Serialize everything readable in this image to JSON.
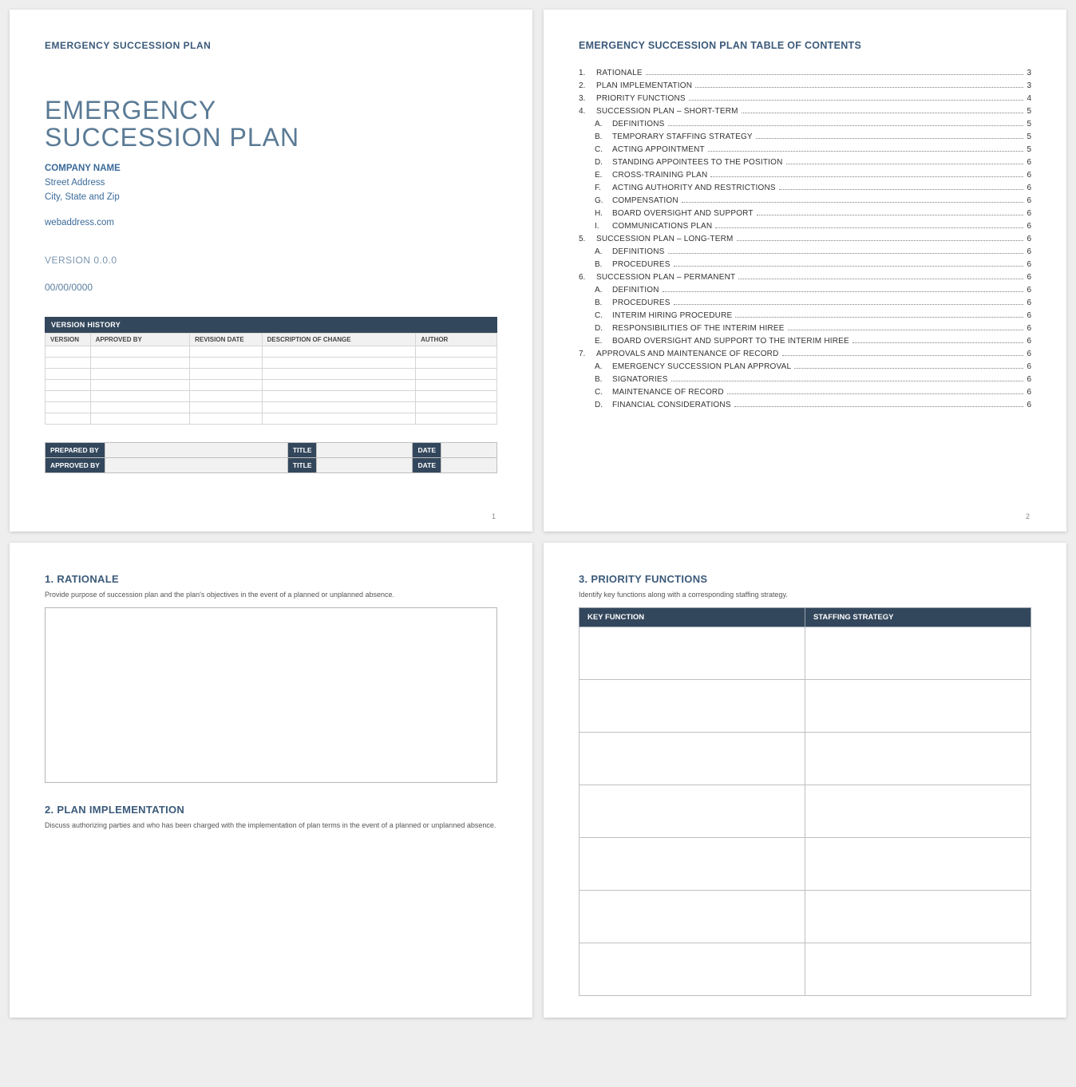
{
  "page1": {
    "header": "EMERGENCY SUCCESSION PLAN",
    "title_line1": "EMERGENCY",
    "title_line2": "SUCCESSION PLAN",
    "company_name": "COMPANY NAME",
    "street": "Street Address",
    "city_state_zip": "City, State and Zip",
    "web": "webaddress.com",
    "version_label": "VERSION 0.0.0",
    "date_label": "00/00/0000",
    "vh_title": "VERSION HISTORY",
    "vh_cols": {
      "c0": "VERSION",
      "c1": "APPROVED BY",
      "c2": "REVISION DATE",
      "c3": "DESCRIPTION OF CHANGE",
      "c4": "AUTHOR"
    },
    "sign": {
      "prepared_by": "PREPARED BY",
      "approved_by": "APPROVED BY",
      "title": "TITLE",
      "date": "DATE"
    },
    "pgnum": "1"
  },
  "page2": {
    "title": "EMERGENCY SUCCESSION PLAN TABLE OF CONTENTS",
    "toc": [
      {
        "m": "1.",
        "t": "RATIONALE",
        "p": "3",
        "sub": false
      },
      {
        "m": "2.",
        "t": "PLAN IMPLEMENTATION",
        "p": "3",
        "sub": false
      },
      {
        "m": "3.",
        "t": "PRIORITY FUNCTIONS",
        "p": "4",
        "sub": false
      },
      {
        "m": "4.",
        "t": "SUCCESSION PLAN – SHORT-TERM",
        "p": "5",
        "sub": false
      },
      {
        "m": "A.",
        "t": "DEFINITIONS",
        "p": "5",
        "sub": true
      },
      {
        "m": "B.",
        "t": "TEMPORARY STAFFING STRATEGY",
        "p": "5",
        "sub": true
      },
      {
        "m": "C.",
        "t": "ACTING APPOINTMENT",
        "p": "5",
        "sub": true
      },
      {
        "m": "D.",
        "t": "STANDING APPOINTEES TO THE POSITION",
        "p": "6",
        "sub": true
      },
      {
        "m": "E.",
        "t": "CROSS-TRAINING PLAN",
        "p": "6",
        "sub": true
      },
      {
        "m": "F.",
        "t": "ACTING AUTHORITY AND RESTRICTIONS",
        "p": "6",
        "sub": true
      },
      {
        "m": "G.",
        "t": "COMPENSATION",
        "p": "6",
        "sub": true
      },
      {
        "m": "H.",
        "t": "BOARD OVERSIGHT AND SUPPORT",
        "p": "6",
        "sub": true
      },
      {
        "m": "I.",
        "t": "COMMUNICATIONS PLAN",
        "p": "6",
        "sub": true
      },
      {
        "m": "5.",
        "t": "SUCCESSION PLAN – LONG-TERM",
        "p": "6",
        "sub": false
      },
      {
        "m": "A.",
        "t": "DEFINITIONS",
        "p": "6",
        "sub": true
      },
      {
        "m": "B.",
        "t": "PROCEDURES",
        "p": "6",
        "sub": true
      },
      {
        "m": "6.",
        "t": "SUCCESSION PLAN – PERMANENT",
        "p": "6",
        "sub": false
      },
      {
        "m": "A.",
        "t": "DEFINITION",
        "p": "6",
        "sub": true
      },
      {
        "m": "B.",
        "t": "PROCEDURES",
        "p": "6",
        "sub": true
      },
      {
        "m": "C.",
        "t": "INTERIM HIRING PROCEDURE",
        "p": "6",
        "sub": true
      },
      {
        "m": "D.",
        "t": "RESPONSIBILITIES OF THE INTERIM HIREE",
        "p": "6",
        "sub": true
      },
      {
        "m": "E.",
        "t": "BOARD OVERSIGHT AND SUPPORT TO THE INTERIM HIREE",
        "p": "6",
        "sub": true
      },
      {
        "m": "7.",
        "t": "APPROVALS AND MAINTENANCE OF RECORD",
        "p": "6",
        "sub": false
      },
      {
        "m": "A.",
        "t": "EMERGENCY SUCCESSION PLAN APPROVAL",
        "p": "6",
        "sub": true
      },
      {
        "m": "B.",
        "t": "SIGNATORIES",
        "p": "6",
        "sub": true
      },
      {
        "m": "C.",
        "t": "MAINTENANCE OF RECORD",
        "p": "6",
        "sub": true
      },
      {
        "m": "D.",
        "t": "FINANCIAL CONSIDERATIONS",
        "p": "6",
        "sub": true
      }
    ],
    "pgnum": "2"
  },
  "page3": {
    "sec1_title": "1.  RATIONALE",
    "sec1_desc": "Provide purpose of succession plan and the plan's objectives in the event of a planned or unplanned absence.",
    "sec2_title": "2.  PLAN IMPLEMENTATION",
    "sec2_desc": "Discuss authorizing parties and who has been charged with the implementation of plan terms in the event of a planned or unplanned absence."
  },
  "page4": {
    "sec_title": "3.  PRIORITY FUNCTIONS",
    "sec_desc": "Identify key functions along with a corresponding staffing strategy.",
    "col1": "KEY FUNCTION",
    "col2": "STAFFING STRATEGY"
  }
}
